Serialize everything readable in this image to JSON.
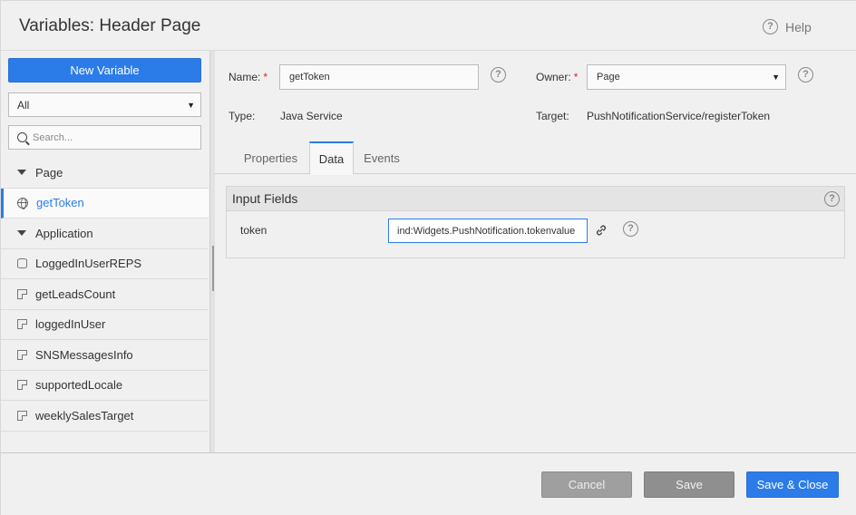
{
  "dialog": {
    "title": "Variables: Header Page",
    "help_label": "Help"
  },
  "sidebar": {
    "new_variable_label": "New Variable",
    "filter_value": "All",
    "search_placeholder": "Search...",
    "groups": [
      {
        "label": "Page"
      },
      {
        "label": "Application"
      }
    ],
    "items": [
      {
        "label": "getToken",
        "icon": "globe-icon"
      },
      {
        "label": "LoggedInUserREPS",
        "icon": "database-icon"
      },
      {
        "label": "getLeadsCount",
        "icon": "service-icon"
      },
      {
        "label": "loggedInUser",
        "icon": "service-icon"
      },
      {
        "label": "SNSMessagesInfo",
        "icon": "service-icon"
      },
      {
        "label": "supportedLocale",
        "icon": "service-icon"
      },
      {
        "label": "weeklySalesTarget",
        "icon": "service-icon"
      }
    ]
  },
  "form": {
    "name_label": "Name:",
    "name_value": "getToken",
    "owner_label": "Owner:",
    "owner_value": "Page",
    "type_label": "Type:",
    "type_value": "Java Service",
    "target_label": "Target:",
    "target_value": "PushNotificationService/registerToken",
    "required_mark": "*"
  },
  "tabs": [
    {
      "label": "Properties"
    },
    {
      "label": "Data"
    },
    {
      "label": "Events"
    }
  ],
  "input_fields": {
    "title": "Input Fields",
    "rows": [
      {
        "label": "token",
        "value": "ind:Widgets.PushNotification.tokenvalue"
      }
    ]
  },
  "footer": {
    "cancel_label": "Cancel",
    "save_label": "Save",
    "save_close_label": "Save & Close"
  },
  "colors": {
    "accent": "#2b7ce9",
    "required": "#d9232d"
  }
}
